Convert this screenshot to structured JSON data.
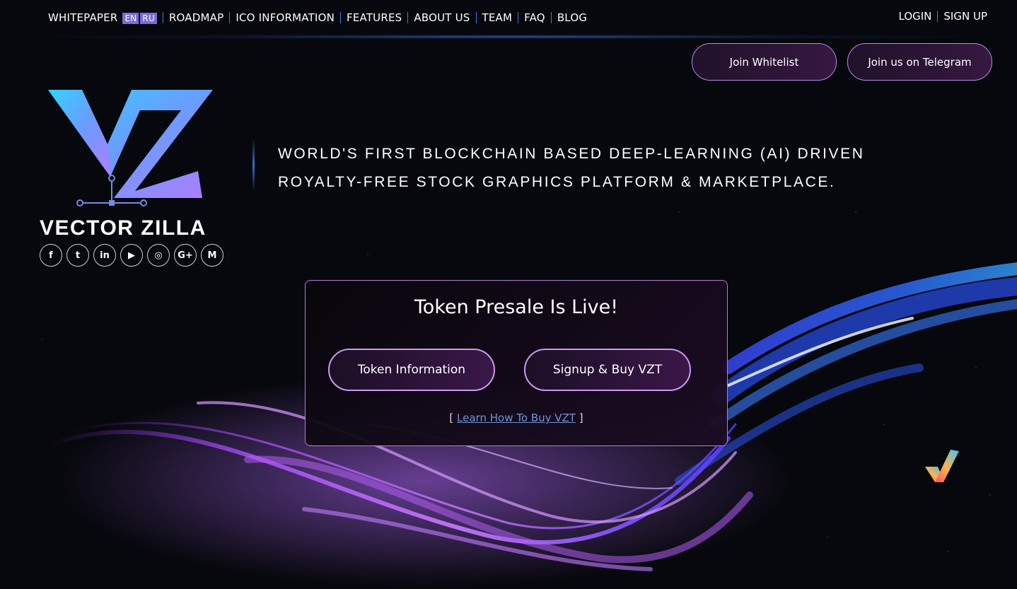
{
  "nav": {
    "whitepaper": "WHITEPAPER",
    "lang_en": "EN",
    "lang_ru": "RU",
    "roadmap": "ROADMAP",
    "ico_information": "ICO INFORMATION",
    "features": "FEATURES",
    "about_us": "ABOUT US",
    "team": "TEAM",
    "faq": "FAQ",
    "blog": "BLOG"
  },
  "auth": {
    "login": "LOGIN",
    "signup": "SIGN UP"
  },
  "header_buttons": {
    "join_whitelist": "Join Whitelist",
    "join_telegram": "Join us on Telegram"
  },
  "brand": {
    "name": "VECTOR ZILLA"
  },
  "socials": [
    {
      "icon": "facebook-icon",
      "glyph": "f"
    },
    {
      "icon": "twitter-icon",
      "glyph": "t"
    },
    {
      "icon": "linkedin-icon",
      "glyph": "in"
    },
    {
      "icon": "youtube-icon",
      "glyph": "▶"
    },
    {
      "icon": "instagram-icon",
      "glyph": "◎"
    },
    {
      "icon": "google-plus-icon",
      "glyph": "G+"
    },
    {
      "icon": "medium-icon",
      "glyph": "M"
    }
  ],
  "tagline": {
    "line1": "WORLD'S FIRST BLOCKCHAIN BASED DEEP-LEARNING (AI) DRIVEN",
    "line2": "ROYALTY-FREE STOCK GRAPHICS PLATFORM & MARKETPLACE."
  },
  "presale": {
    "title": "Token Presale Is Live!",
    "token_info_button": "Token Information",
    "signup_buy_button": "Signup & Buy VZT",
    "learn_open": "[",
    "learn_link": "Learn How To Buy VZT",
    "learn_close": "]"
  },
  "colors": {
    "background": "#07080d",
    "accent_purple": "#b48de0",
    "nav_separator": "#3f7fd6",
    "lang_badge": "#7b6bd8",
    "link": "#6f95d6"
  }
}
